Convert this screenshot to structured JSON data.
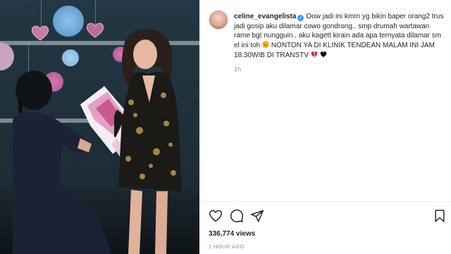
{
  "post": {
    "username": "celine_evangelista",
    "caption_text": "Oow jadi ini kmrn yg bikin baper orang2 trus jadi gosip aku dilamar cowo gondrong.. smp drumah wartawan rame bgt nungguin.. aku kagett kirain ada apa ternyata dilamar sm el ini toh",
    "caption_text2": "NONTON YA DI KLINIK TENDEAN MALAM INI JAM 18.30WIB DI TRANSTV",
    "age": "1h",
    "views": "336,774 views",
    "timestamp": "1 HOUR AGO"
  },
  "icons": {
    "like": "heart-outline-icon",
    "comment": "comment-bubble-icon",
    "share": "paper-plane-icon",
    "save": "bookmark-icon",
    "verified": "verified-badge-icon"
  },
  "colors": {
    "verified": "#3897f0",
    "text": "#262626",
    "muted": "#8e8e8e"
  }
}
